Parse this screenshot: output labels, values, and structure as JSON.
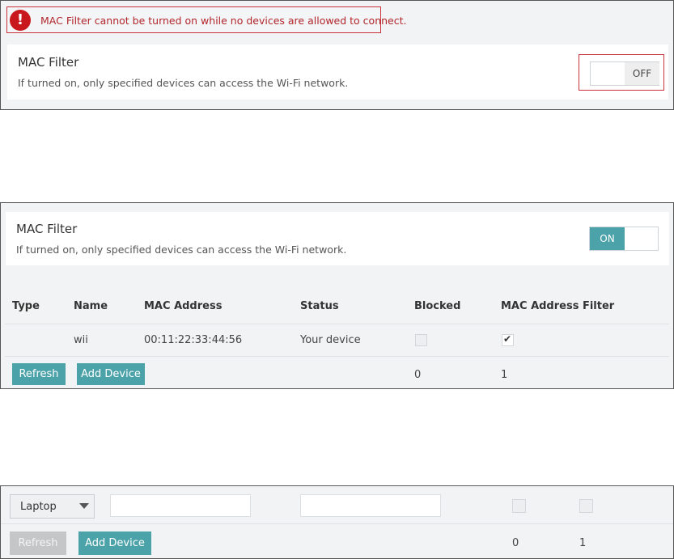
{
  "error_banner": {
    "icon": "exclamation-icon",
    "icon_glyph": "!",
    "message": "MAC Filter cannot be turned on while no devices are allowed to connect."
  },
  "mac_filter": {
    "title": "MAC Filter",
    "description": "If turned on, only specified devices can access the Wi-Fi network."
  },
  "toggle_off": {
    "label": "OFF",
    "state": "off"
  },
  "toggle_on": {
    "label": "ON",
    "state": "on"
  },
  "table": {
    "headers": [
      "Type",
      "Name",
      "MAC Address",
      "Status",
      "Blocked",
      "MAC Address Filter"
    ],
    "row": {
      "type": "",
      "name": "wii",
      "mac": "00:11:22:33:44:56",
      "status": "Your device",
      "blocked": false,
      "mac_filter": true
    },
    "refresh_label": "Refresh",
    "add_device_label": "Add Device",
    "blocked_count": "0",
    "filter_count": "1"
  },
  "add_form": {
    "type_selected": "Laptop",
    "name_value": "",
    "mac_value": "",
    "blocked": false,
    "mac_filter": false,
    "refresh_label": "Refresh",
    "refresh_disabled": true,
    "add_device_label": "Add Device",
    "blocked_count": "0",
    "filter_count": "1"
  },
  "colors": {
    "accent": "#4ba2a8",
    "error": "#c8181e",
    "error_border": "#c9323c",
    "panel_bg": "#f2f3f4",
    "disabled": "#c4c6c8"
  }
}
